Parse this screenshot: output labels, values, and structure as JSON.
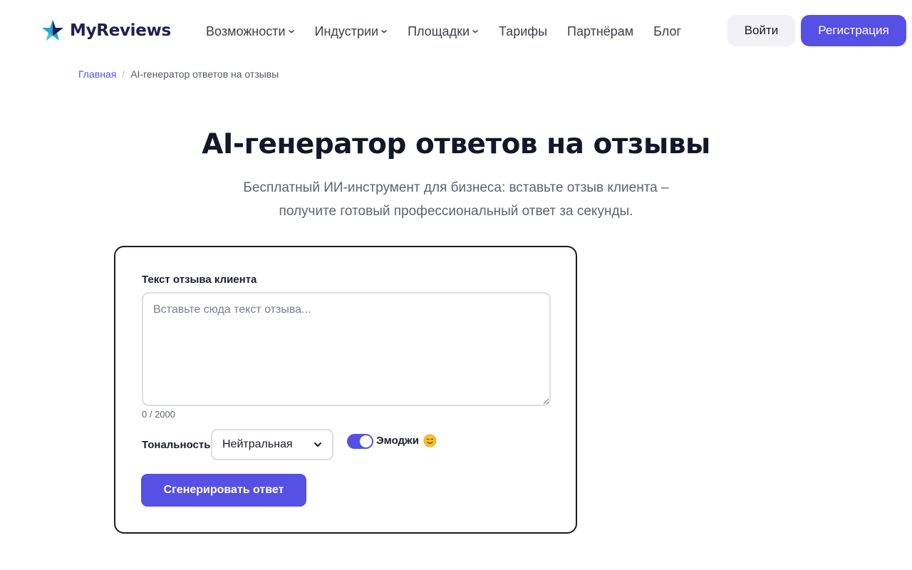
{
  "header": {
    "brand": "MyReviews",
    "nav": [
      {
        "label": "Возможности",
        "has_dropdown": true
      },
      {
        "label": "Индустрии",
        "has_dropdown": true
      },
      {
        "label": "Площадки",
        "has_dropdown": true
      },
      {
        "label": "Тарифы",
        "has_dropdown": false
      },
      {
        "label": "Партнёрам",
        "has_dropdown": false
      },
      {
        "label": "Блог",
        "has_dropdown": false
      }
    ],
    "login_label": "Войти",
    "register_label": "Регистрация"
  },
  "breadcrumb": {
    "home": "Главная",
    "separator": "/",
    "current": "AI-генератор ответов на отзывы"
  },
  "hero": {
    "title": "AI-генератор ответов на отзывы",
    "subtitle_line1": "Бесплатный ИИ-инструмент для бизнеса: вставьте отзыв клиента –",
    "subtitle_line2": "получите готовый профессиональный ответ за секунды."
  },
  "form": {
    "review_label": "Текст отзыва клиента",
    "review_value": "",
    "review_placeholder": "Вставьте сюда текст отзыва...",
    "char_count": "0 / 2000",
    "tone_label": "Тональность",
    "tone_selected": "Нейтральная",
    "emoji_label": "Эмоджи",
    "emoji_enabled": true,
    "emoji_icon": "smiling-face-icon",
    "generate_label": "Сгенерировать ответ"
  },
  "colors": {
    "accent": "#5650e5",
    "brand_text": "#1d2050",
    "logo_star_blue": "#1fa4d9",
    "logo_star_dark": "#1d2050"
  }
}
